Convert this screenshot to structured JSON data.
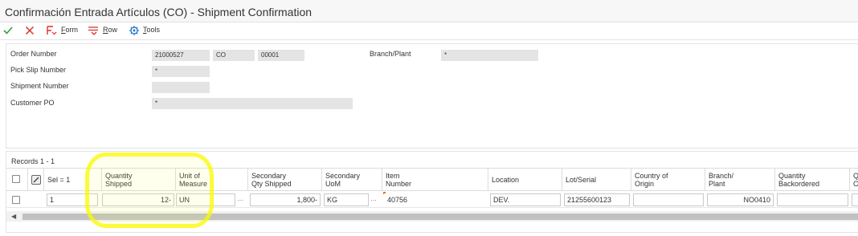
{
  "window": {
    "title": "Confirmación Entrada Artículos (CO) - Shipment Confirmation"
  },
  "toolbar": {
    "form_label_prefix": "F",
    "form_label_rest": "orm",
    "row_label_prefix": "R",
    "row_label_rest": "ow",
    "tools_label_prefix": "T",
    "tools_label_rest": "ools",
    "icons": [
      "check-icon",
      "close-icon",
      "form-icon",
      "row-icon",
      "tools-icon"
    ],
    "colors": {
      "check": "#2e9e3e",
      "close": "#d9302c",
      "form": "#d9302c",
      "row": "#d9302c",
      "tools": "#2b7bd3"
    }
  },
  "form": {
    "order_number": {
      "label": "Order Number",
      "value": "21000527",
      "type": "CO",
      "company": "00001"
    },
    "branch_plant": {
      "label": "Branch/Plant",
      "value": "*"
    },
    "pick_slip_number": {
      "label": "Pick Slip Number",
      "value": "*"
    },
    "shipment_number": {
      "label": "Shipment Number",
      "value": ""
    },
    "customer_po": {
      "label": "Customer PO",
      "value": "*"
    }
  },
  "grid": {
    "records": "Records 1 - 1",
    "headers": {
      "sel": "Sel = 1",
      "quantity_shipped": "Quantity\nShipped",
      "unit_of_measure": "Unit of\nMeasure",
      "secondary_qty_shipped": "Secondary\nQty Shipped",
      "secondary_uom": "Secondary\nUoM",
      "item_number": "Item\nNumber",
      "location": "Location",
      "lot_serial": "Lot/Serial",
      "country_of_origin": "Country of\nOrigin",
      "branch_plant": "Branch/\nPlant",
      "quantity_backordered": "Quantity\nBackordered",
      "next": "Q\nC"
    },
    "rows": [
      {
        "sel": "1",
        "quantity_shipped": "12-",
        "unit_of_measure": "UN",
        "secondary_qty_shipped": "1,800-",
        "secondary_uom": "KG",
        "item_number": "40756",
        "location": "DEV.",
        "lot_serial": "21255600123",
        "country_of_origin": "",
        "branch_plant": "NO0410",
        "quantity_backordered": ""
      }
    ]
  },
  "annotation": {
    "color": "#f5f500"
  }
}
